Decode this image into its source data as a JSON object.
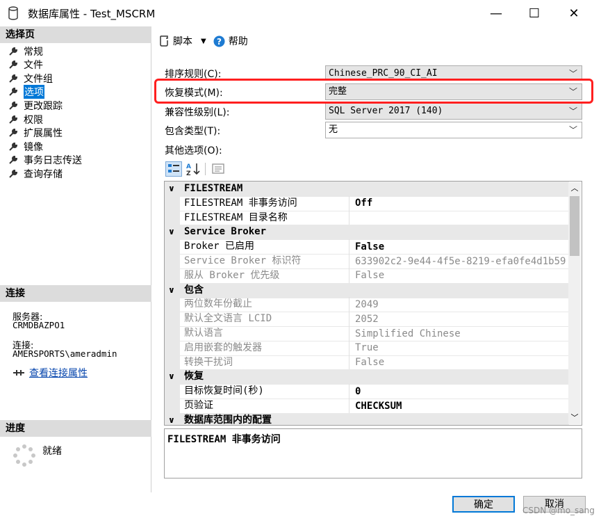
{
  "window": {
    "title": "数据库属性 - Test_MSCRM",
    "minimize": "—",
    "maximize": "☐",
    "close": "✕"
  },
  "left": {
    "select_page_header": "选择页",
    "nav_items": [
      {
        "label": "常规"
      },
      {
        "label": "文件"
      },
      {
        "label": "文件组"
      },
      {
        "label": "选项",
        "selected": true
      },
      {
        "label": "更改跟踪"
      },
      {
        "label": "权限"
      },
      {
        "label": "扩展属性"
      },
      {
        "label": "镜像"
      },
      {
        "label": "事务日志传送"
      },
      {
        "label": "查询存储"
      }
    ],
    "connection_header": "连接",
    "server_label": "服务器:",
    "server_value": "CRMDBAZPO1",
    "connection_label": "连接:",
    "connection_value": "AMERSPORTS\\ameradmin",
    "view_connection_link": "查看连接属性",
    "progress_header": "进度",
    "progress_status": "就绪"
  },
  "toolbar": {
    "script_label": "脚本",
    "help_label": "帮助"
  },
  "fields": {
    "collation_label": "排序规则(C):",
    "collation_value": "Chinese_PRC_90_CI_AI",
    "recovery_label": "恢复模式(M):",
    "recovery_value": "完整",
    "compat_label": "兼容性级别(L):",
    "compat_value": "SQL Server 2017 (140)",
    "containment_label": "包含类型(T):",
    "containment_value": "无",
    "other_options_label": "其他选项(O):"
  },
  "grid": {
    "rows": [
      {
        "type": "cat",
        "name": "FILESTREAM"
      },
      {
        "type": "prop",
        "name": "FILESTREAM 非事务访问",
        "value": "Off",
        "style": "bold"
      },
      {
        "type": "prop",
        "name": "FILESTREAM 目录名称",
        "value": ""
      },
      {
        "type": "cat",
        "name": "Service Broker"
      },
      {
        "type": "prop",
        "name": "Broker 已启用",
        "value": "False",
        "style": "bold"
      },
      {
        "type": "prop",
        "name": "Service Broker 标识符",
        "value": "633902c2-9e44-4f5e-8219-efa0fe4d1b59",
        "style": "grey"
      },
      {
        "type": "prop",
        "name": "服从 Broker 优先级",
        "value": "False",
        "style": "grey"
      },
      {
        "type": "cat",
        "name": "包含"
      },
      {
        "type": "prop",
        "name": "两位数年份截止",
        "value": "2049",
        "style": "grey"
      },
      {
        "type": "prop",
        "name": "默认全文语言 LCID",
        "value": "2052",
        "style": "grey"
      },
      {
        "type": "prop",
        "name": "默认语言",
        "value": "Simplified Chinese",
        "style": "grey"
      },
      {
        "type": "prop",
        "name": "启用嵌套的触发器",
        "value": "True",
        "style": "grey"
      },
      {
        "type": "prop",
        "name": "转换干扰词",
        "value": "False",
        "style": "grey"
      },
      {
        "type": "cat",
        "name": "恢复"
      },
      {
        "type": "prop",
        "name": "目标恢复时间(秒)",
        "value": "0",
        "style": "bold"
      },
      {
        "type": "prop",
        "name": "页验证",
        "value": "CHECKSUM",
        "style": "bold"
      },
      {
        "type": "cat",
        "name": "数据库范围内的配置"
      }
    ]
  },
  "description": "FILESTREAM 非事务访问",
  "buttons": {
    "ok": "确定",
    "cancel": "取消"
  },
  "watermark": "CSDN @mo_sang"
}
